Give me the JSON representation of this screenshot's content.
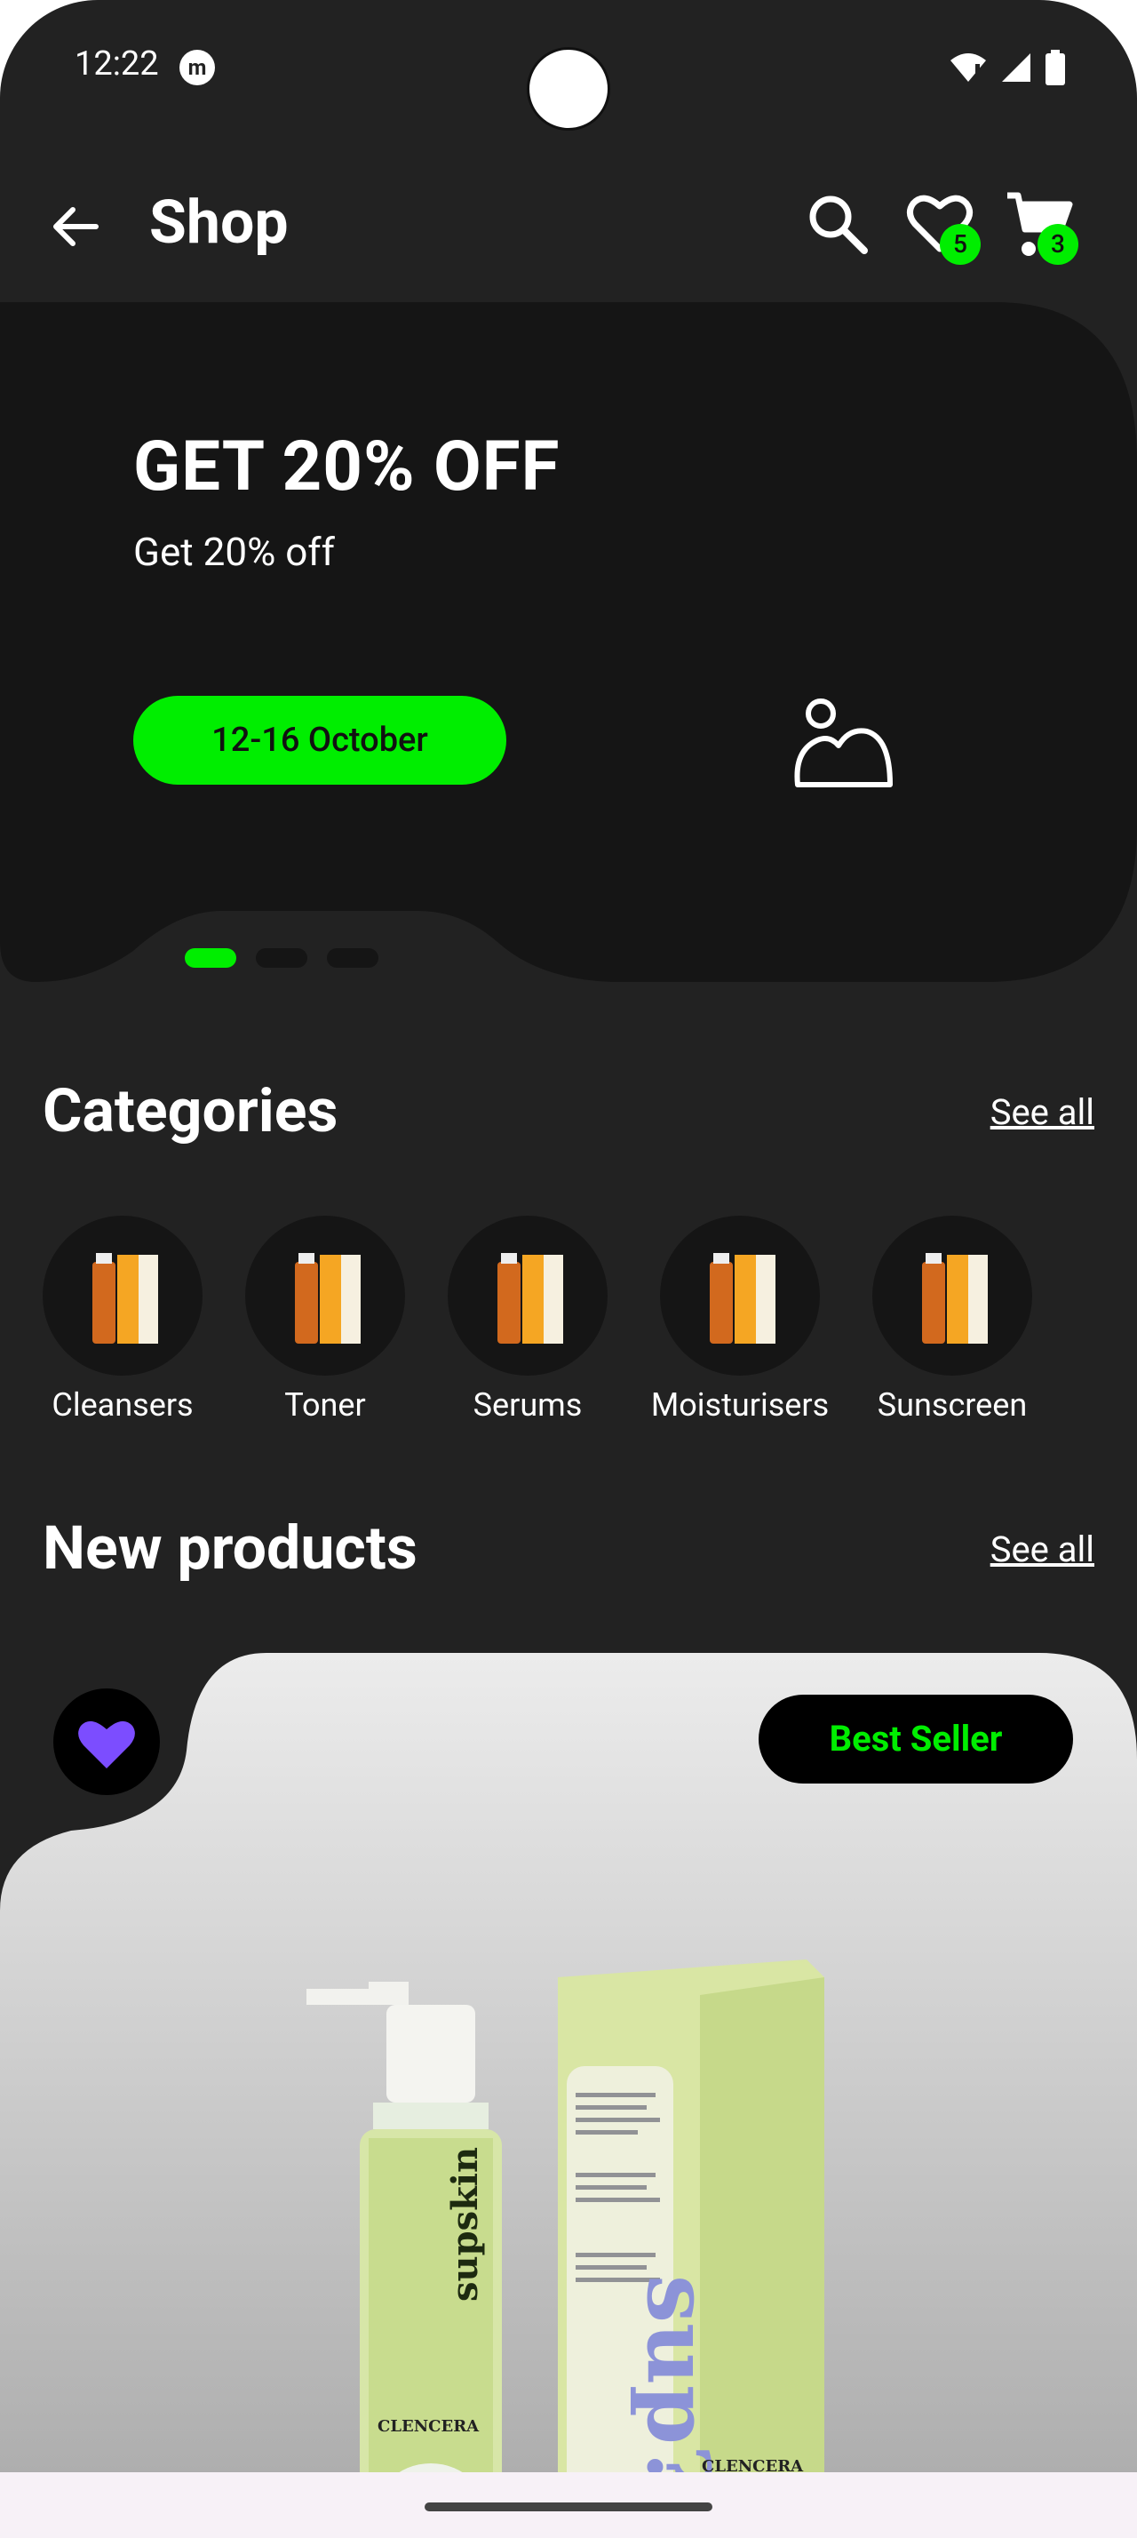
{
  "status_bar": {
    "time": "12:22",
    "app_icon_letter": "m"
  },
  "app_bar": {
    "title": "Shop",
    "back_icon": "arrow-left-icon",
    "search_icon": "search-icon",
    "wishlist_count": "5",
    "cart_count": "3"
  },
  "banner": {
    "title": "GET 20% OFF",
    "subtitle": "Get 20% off",
    "date_pill": "12-16 October",
    "image_icon": "image-placeholder-icon",
    "carousel": {
      "count": 3,
      "active_index": 0
    }
  },
  "categories": {
    "title": "Categories",
    "see_all": "See all",
    "items": [
      {
        "label": "Cleansers"
      },
      {
        "label": "Toner"
      },
      {
        "label": "Serums"
      },
      {
        "label": "Moisturisers"
      },
      {
        "label": "Sunscreen"
      }
    ]
  },
  "new_products": {
    "title": "New products",
    "see_all": "See all",
    "card": {
      "badge": "Best Seller",
      "favorited": true,
      "bottle_brand": "supskin",
      "bottle_product": "CLENCERA",
      "box_brand": "sup?",
      "box_product": "CLENCERA"
    }
  },
  "colors": {
    "background": "#222222",
    "accent": "#00ee00",
    "favorite": "#7c4dff",
    "card_gradient_top": "#ececec",
    "card_gradient_bottom": "#a9a9a9"
  }
}
